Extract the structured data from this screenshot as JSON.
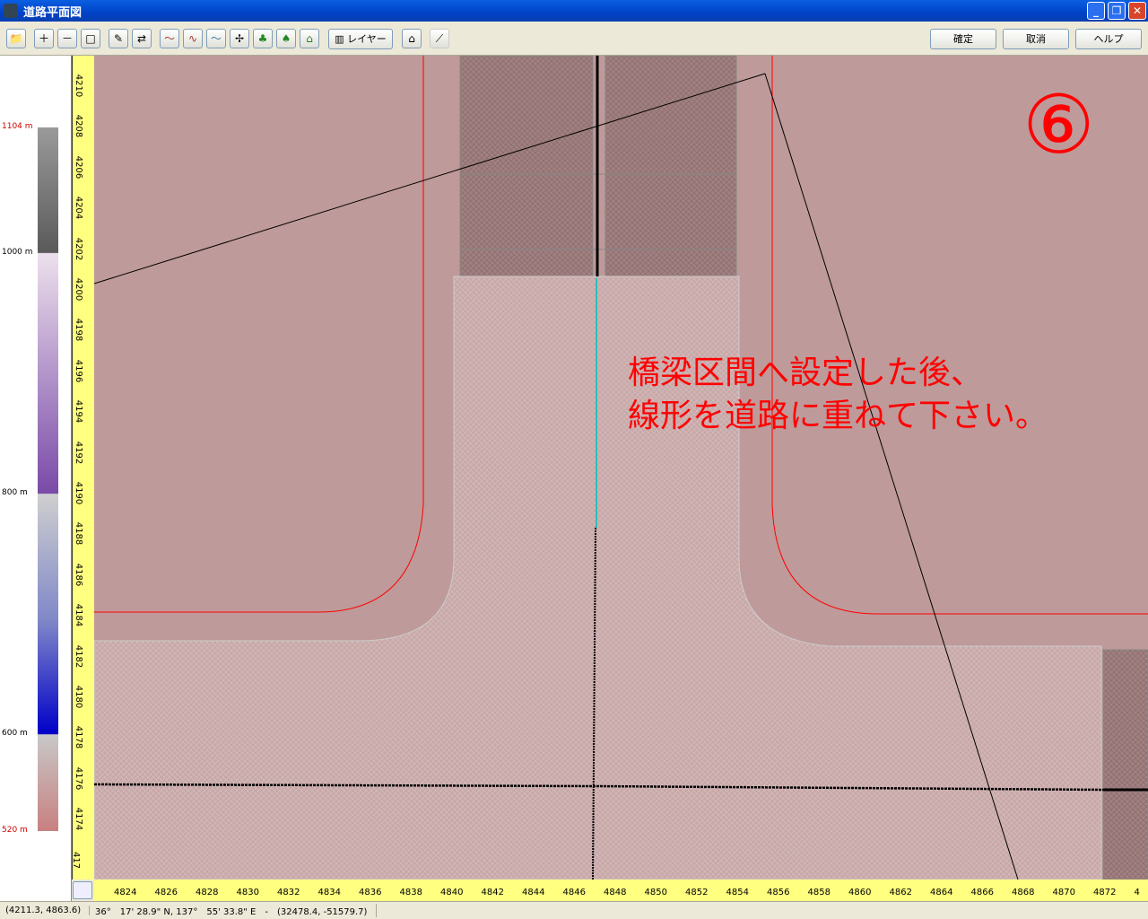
{
  "window": {
    "title": "道路平面図",
    "minimize": "_",
    "restore": "❐",
    "close": "✕"
  },
  "toolbar": {
    "layer_label": "レイヤー",
    "confirm": "確定",
    "cancel": "取消",
    "help": "ヘルプ"
  },
  "legend": {
    "labels": [
      "1104 m",
      "1000 m",
      "800 m",
      "600 m",
      "520 m"
    ]
  },
  "rulers": {
    "horizontal": [
      "4824",
      "4826",
      "4828",
      "4830",
      "4832",
      "4834",
      "4836",
      "4838",
      "4840",
      "4842",
      "4844",
      "4846",
      "4848",
      "4850",
      "4852",
      "4854",
      "4856",
      "4858",
      "4860",
      "4862",
      "4864",
      "4866",
      "4868",
      "4870",
      "4872",
      "4"
    ],
    "vertical": [
      "4210",
      "4208",
      "4206",
      "4204",
      "4202",
      "4200",
      "4198",
      "4196",
      "4194",
      "4192",
      "4190",
      "4188",
      "4186",
      "4184",
      "4182",
      "4180",
      "4178",
      "4176",
      "4174",
      "417"
    ]
  },
  "annotation": {
    "step": "⑥",
    "note": "橋梁区間へ設定した後、\n線形を道路に重ねて下さい。"
  },
  "status": {
    "local": "(4211.3, 4863.6)",
    "geo": "36°　17' 28.9\" N, 137°　55' 33.8\" E　-　(32478.4, -51579.7)"
  }
}
